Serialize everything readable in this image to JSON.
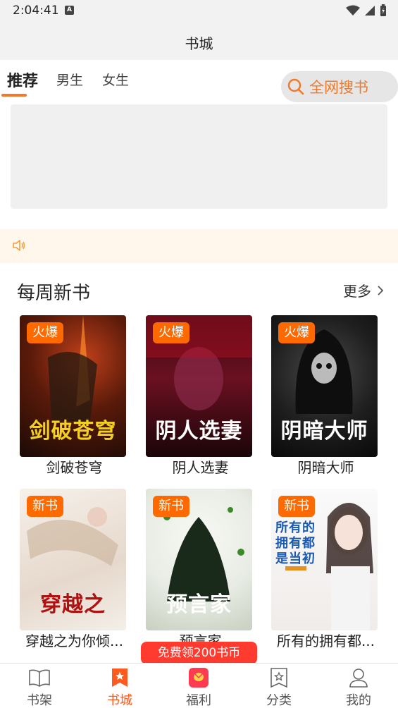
{
  "status_bar": {
    "time": "2:04:41",
    "notification_badge": "A"
  },
  "header": {
    "title": "书城"
  },
  "tabs": [
    {
      "label": "推荐",
      "active": true
    },
    {
      "label": "男生",
      "active": false
    },
    {
      "label": "女生",
      "active": false
    }
  ],
  "search": {
    "label": "全网搜书"
  },
  "section": {
    "title": "每周新书",
    "more": "更多"
  },
  "books": [
    {
      "name": "剑破苍穹",
      "badge": "火爆",
      "cover_text": "剑破苍穹"
    },
    {
      "name": "阴人选妻",
      "badge": "火爆",
      "cover_text": "阴人选妻"
    },
    {
      "name": "阴暗大师",
      "badge": "火爆",
      "cover_text": "阴暗大师"
    },
    {
      "name": "穿越之为你倾...",
      "badge": "新书",
      "cover_text": "穿越之"
    },
    {
      "name": "预言家",
      "badge": "新书",
      "cover_text": "预言家"
    },
    {
      "name": "所有的拥有都...",
      "badge": "新书",
      "cover_text": "所有的拥有都是当初"
    }
  ],
  "promo": {
    "label": "免费领200书币"
  },
  "bottom_nav": [
    {
      "label": "书架",
      "icon": "book-open-icon"
    },
    {
      "label": "书城",
      "icon": "bookmark-star-icon",
      "active": true
    },
    {
      "label": "福利",
      "icon": "gift-icon"
    },
    {
      "label": "分类",
      "icon": "category-star-icon"
    },
    {
      "label": "我的",
      "icon": "user-icon"
    }
  ],
  "colors": {
    "accent": "#f07a2a",
    "promo": "#ff3b30",
    "badge": "#ff6a00"
  }
}
